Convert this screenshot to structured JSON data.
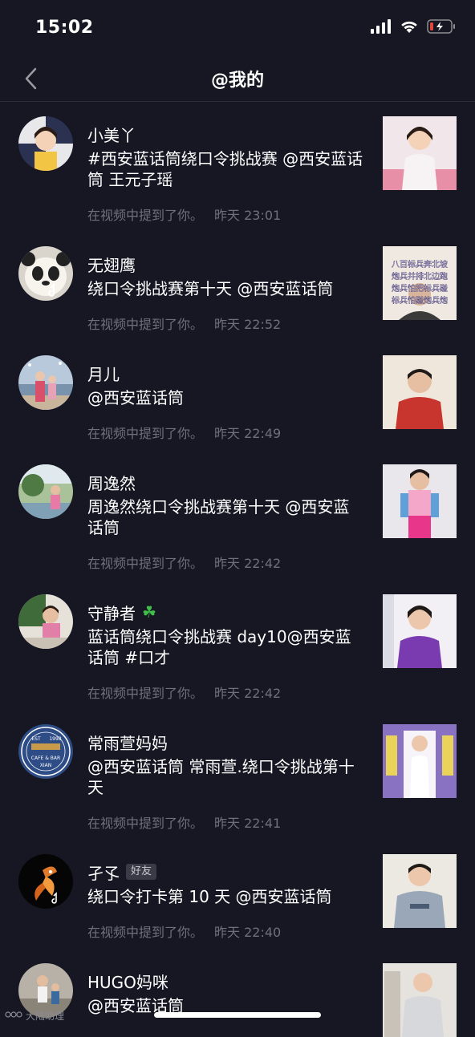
{
  "status": {
    "time": "15:02"
  },
  "header": {
    "title": "@我的"
  },
  "mention_text": "在视频中提到了你。",
  "items": [
    {
      "username": "小美丫",
      "message": "#西安蓝话筒绕口令挑战赛 @西安蓝话筒 王元子瑶",
      "time": "昨天 23:01"
    },
    {
      "username": "无翅鹰",
      "message": "绕口令挑战赛第十天 @西安蓝话筒",
      "time": "昨天 22:52",
      "thumb_caption": [
        "八百标兵奔北坡",
        "炮兵并排北边跑",
        "炮兵怕把标兵碰",
        "标兵怕碰炮兵炮"
      ]
    },
    {
      "username": "月儿",
      "message": "@西安蓝话筒",
      "time": "昨天 22:49"
    },
    {
      "username": "周逸然",
      "message": "周逸然绕口令挑战赛第十天 @西安蓝话筒",
      "time": "昨天 22:42"
    },
    {
      "username": "守静者",
      "message": "蓝话筒绕口令挑战赛 day10@西安蓝话筒 #口才",
      "time": "昨天 22:42"
    },
    {
      "username": "常雨萱妈妈",
      "message": "@西安蓝话筒 常雨萱.绕口令挑战第十天",
      "time": "昨天 22:41",
      "avatar_text": [
        "EST",
        "1998",
        "CAFE & BAR",
        "XIAN"
      ]
    },
    {
      "username": "孑孓",
      "badge": "好友",
      "message": "绕口令打卡第 10 天 @西安蓝话筒",
      "time": "昨天 22:40"
    },
    {
      "username": "HUGO妈咪",
      "message": "@西安蓝话筒",
      "time": ""
    }
  ],
  "watermark": "大陆助理",
  "colors": {
    "background": "#161722",
    "secondary_text": "#6e707b",
    "battery_low": "#e5453a"
  }
}
